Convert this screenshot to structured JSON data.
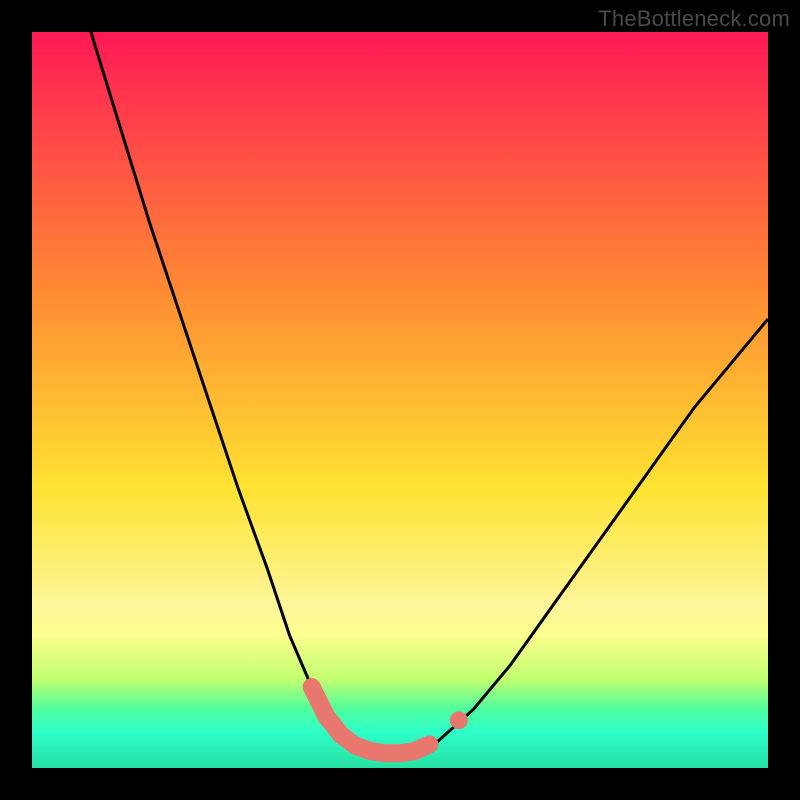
{
  "watermark": "TheBottleneck.com",
  "chart_data": {
    "type": "line",
    "title": "",
    "xlabel": "",
    "ylabel": "",
    "xlim": [
      0,
      100
    ],
    "ylim": [
      0,
      100
    ],
    "series": [
      {
        "name": "bottleneck-curve",
        "x": [
          8,
          12,
          16,
          20,
          24,
          28,
          32,
          35,
          38,
          40,
          42,
          44,
          46,
          48,
          50,
          52,
          55,
          60,
          65,
          70,
          75,
          80,
          85,
          90,
          95,
          100
        ],
        "y": [
          100,
          87,
          74,
          62,
          50,
          38,
          27,
          18,
          11,
          7,
          4.5,
          3,
          2.3,
          2,
          2,
          2.3,
          3.5,
          8,
          14,
          21,
          28,
          35,
          42,
          49,
          55,
          61
        ]
      }
    ],
    "markers": [
      {
        "name": "valley-segment",
        "x": [
          38,
          40,
          42,
          44,
          46,
          48,
          50,
          52,
          54
        ],
        "y": [
          11,
          7,
          4.5,
          3,
          2.3,
          2,
          2,
          2.3,
          3.2
        ]
      },
      {
        "name": "right-dot",
        "x": [
          58
        ],
        "y": [
          6.5
        ]
      }
    ],
    "colors": {
      "curve_stroke": "#000000",
      "marker_fill": "#e8776e",
      "gradient_top": "#ff1955",
      "gradient_mid": "#ffe332",
      "gradient_bottom": "#26e0a2"
    }
  }
}
